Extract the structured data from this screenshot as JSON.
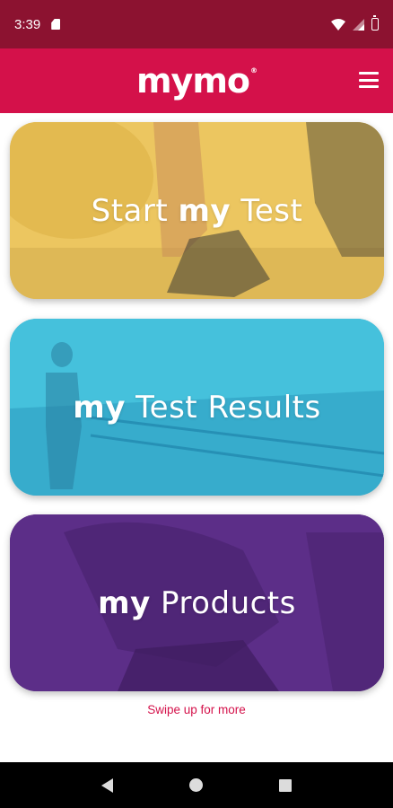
{
  "status_bar": {
    "time": "3:39"
  },
  "app_bar": {
    "logo": "mymo",
    "logo_mark": "®"
  },
  "cards": [
    {
      "prefix": "Start ",
      "my": "my",
      "suffix": " Test",
      "color": "#e9c35a"
    },
    {
      "prefix": "",
      "my": "my",
      "suffix": " Test Results",
      "color": "#3fb8d6"
    },
    {
      "prefix": "",
      "my": "my",
      "suffix": " Products",
      "color": "#5b2d86"
    }
  ],
  "swipe_hint": "Swipe up for more",
  "colors": {
    "status_bar": "#8c1230",
    "app_bar": "#d4114a",
    "accent": "#d4114a"
  }
}
